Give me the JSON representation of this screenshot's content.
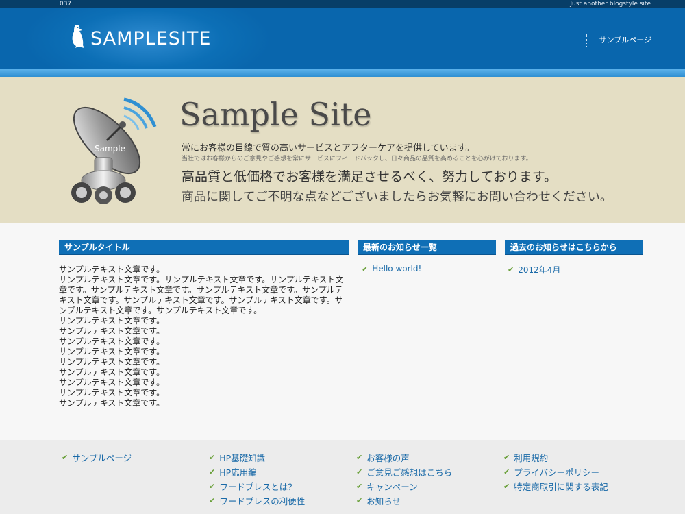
{
  "topbar": {
    "number": "037",
    "tagline": "Just another blogstyle site"
  },
  "header": {
    "logo_text": "SAMPLESITE",
    "nav": [
      {
        "label": "サンプルページ"
      }
    ]
  },
  "hero": {
    "title": "Sample Site",
    "image_label": "Sample",
    "line1": "常にお客様の目線で質の高いサービスとアフターケアを提供しています。",
    "line2": "当社ではお客様からのご意見やご感想を常にサービスにフィードバックし、日々商品の品質を高めることを心がけております。",
    "line3": "高品質と低価格でお客様を満足させるべく、努力しております。",
    "line4": "商品に関してご不明な点などございましたらお気軽にお問い合わせください。"
  },
  "main": {
    "col1_title": "サンプルタイトル",
    "col1_paragraphs": [
      "サンプルテキスト文章です。",
      "サンプルテキスト文章です。サンプルテキスト文章です。サンプルテキスト文章です。サンプルテキスト文章です。サンプルテキスト文章です。サンプルテキスト文章です。サンプルテキスト文章です。サンプルテキスト文章です。サンプルテキスト文章です。サンプルテキスト文章です。",
      "サンプルテキスト文章です。",
      "サンプルテキスト文章です。",
      "サンプルテキスト文章です。",
      "サンプルテキスト文章です。",
      "サンプルテキスト文章です。",
      "サンプルテキスト文章です。",
      "サンプルテキスト文章です。",
      "サンプルテキスト文章です。",
      "サンプルテキスト文章です。"
    ],
    "col2_title": "最新のお知らせ一覧",
    "col2_items": [
      "Hello world!"
    ],
    "col3_title": "過去のお知らせはこちらから",
    "col3_items": [
      "2012年4月"
    ]
  },
  "footer": {
    "col1": [
      "サンプルページ"
    ],
    "col2": [
      "HP基礎知識",
      "HP応用編",
      "ワードプレスとは？",
      "ワードプレスの利便性"
    ],
    "col3": [
      "お客様の声",
      "ご意見ご感想はこちら",
      "キャンペーン",
      "お知らせ"
    ],
    "col4": [
      "利用規約",
      "プライバシーポリシー",
      "特定商取引に関する表記"
    ]
  },
  "colors": {
    "header_blue": "#0c6fb6",
    "hero_beige": "#e4dec4",
    "link_blue": "#1a6aa8",
    "check_green": "#6aa03a"
  }
}
